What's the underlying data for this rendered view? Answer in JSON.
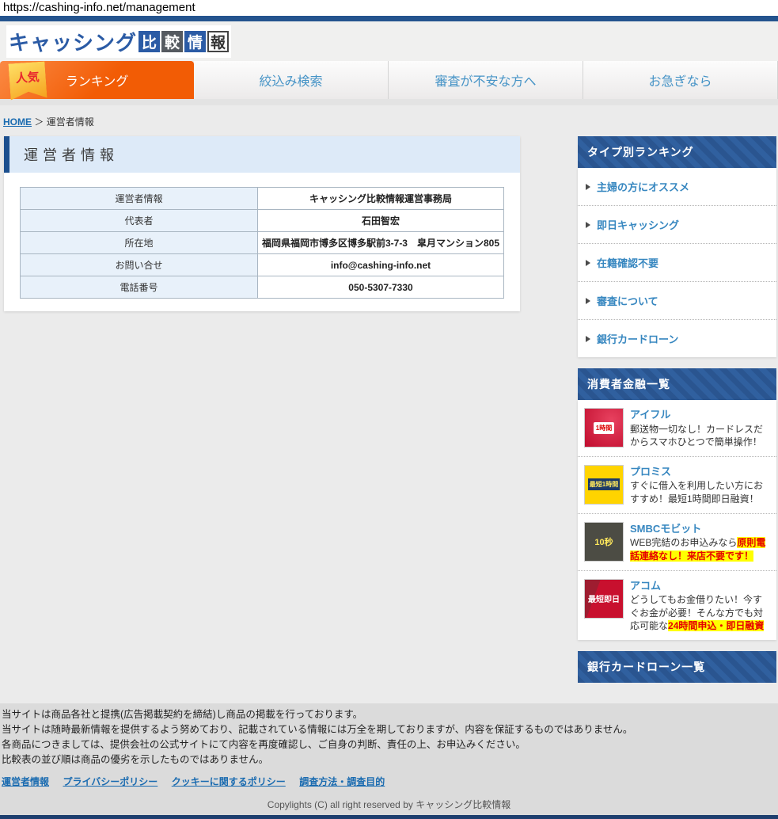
{
  "browser": {
    "url": "https://cashing-info.net/management"
  },
  "header": {
    "logo": {
      "text": "キャッシング",
      "box1": "比",
      "box2": "較",
      "box3": "情",
      "box4": "報"
    }
  },
  "nav": {
    "badge": "人気",
    "tabs": [
      {
        "label": "ランキング",
        "active": true
      },
      {
        "label": "絞込み検索",
        "active": false
      },
      {
        "label": "審査が不安な方へ",
        "active": false
      },
      {
        "label": "お急ぎなら",
        "active": false
      }
    ]
  },
  "breadcrumb": {
    "home": "HOME",
    "separator": "＞",
    "current": "運営者情報"
  },
  "main": {
    "title": "運営者情報",
    "table_rows": [
      {
        "label": "運営者情報",
        "value": "キャッシング比較情報運営事務局"
      },
      {
        "label": "代表者",
        "value": "石田智宏"
      },
      {
        "label": "所在地",
        "value": "福岡県福岡市博多区博多駅前3-7-3　皐月マンション805"
      },
      {
        "label": "お問い合せ",
        "value": "info@cashing-info.net"
      },
      {
        "label": "電話番号",
        "value": "050-5307-7330"
      }
    ]
  },
  "sidebar": {
    "ranking": {
      "title": "タイプ別ランキング",
      "items": [
        {
          "label": "主婦の方にオススメ"
        },
        {
          "label": "即日キャッシング"
        },
        {
          "label": "在籍確認不要"
        },
        {
          "label": "審査について"
        },
        {
          "label": "銀行カードローン"
        }
      ]
    },
    "consumer_finance": {
      "title": "消費者金融一覧",
      "items": [
        {
          "name": "アイフル",
          "desc": "郵送物一切なし！カードレスだからスマホひとつで簡単操作！",
          "highlight": "",
          "thumb_text": "1時間"
        },
        {
          "name": "プロミス",
          "desc": "すぐに借入を利用したい方におすすめ！最短1時間即日融資！",
          "highlight": "",
          "thumb_text": "最短1時間"
        },
        {
          "name": "SMBCモビット",
          "desc": "WEB完結のお申込みなら",
          "highlight": "原則電話連絡なし！来店不要です！",
          "thumb_text": "10秒"
        },
        {
          "name": "アコム",
          "desc": "どうしてもお金借りたい！今すぐお金が必要！そんな方でも対応可能な",
          "highlight": "24時間申込・即日融資",
          "thumb_text": "最短即日"
        }
      ]
    },
    "bank_loans": {
      "title": "銀行カードローン一覧"
    }
  },
  "footer": {
    "disclaimers": [
      "当サイトは商品各社と提携(広告掲載契約を締結)し商品の掲載を行っております。",
      "当サイトは随時最新情報を提供するよう努めており、記載されている情報には万全を期しておりますが、内容を保証するものではありません。",
      "各商品につきましては、提供会社の公式サイトにて内容を再度確認し、ご自身の判断、責任の上、お申込みください。",
      "比較表の並び順は商品の優劣を示したものではありません。"
    ],
    "links": [
      {
        "label": "運営者情報"
      },
      {
        "label": "プライバシーポリシー"
      },
      {
        "label": "クッキーに関するポリシー"
      },
      {
        "label": "調査方法・調査目的"
      }
    ],
    "copyright": "Copylights (C) all right reserved by キャッシング比較情報"
  },
  "colors": {
    "navy": "#24548e",
    "accent_orange": "#f25c05",
    "link_blue": "#3787c0",
    "sidebar_header_blue": "#2a5590",
    "highlight_bg": "#ffff00",
    "highlight_text": "#e60000"
  }
}
